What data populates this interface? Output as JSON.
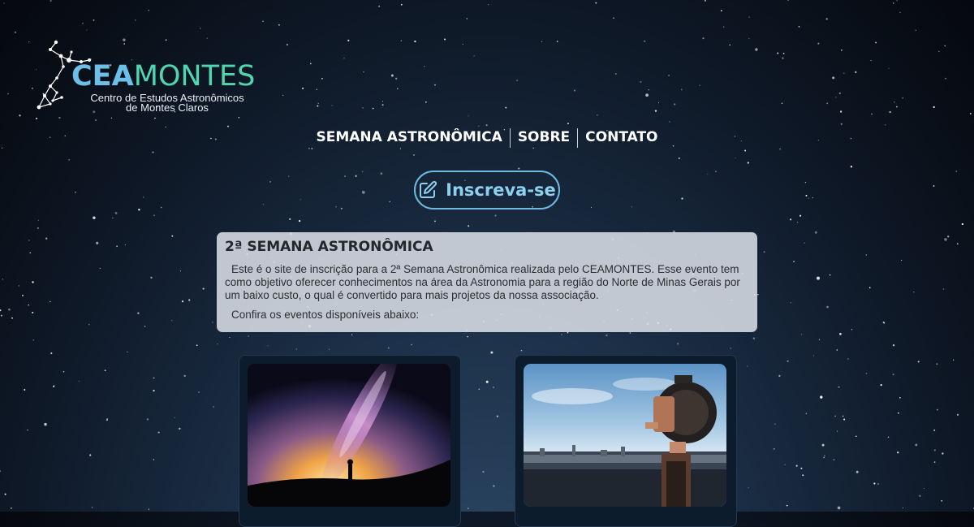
{
  "brand": {
    "logo_primary": "CEA",
    "logo_secondary": "MONTES",
    "logo_sub_line1": "Centro de Estudos Astronômicos",
    "logo_sub_line2": "de Montes Claros"
  },
  "nav": {
    "items": [
      "SEMANA ASTRONÔMICA",
      "SOBRE",
      "CONTATO"
    ]
  },
  "cta": {
    "label": "Inscreva-se",
    "icon": "edit-icon"
  },
  "intro": {
    "title": "2ª SEMANA ASTRONÔMICA",
    "paragraph": "Este é o site de inscrição para a 2ª Semana Astronômica realizada pelo CEAMONTES. Esse evento tem como objetivo oferecer conhecimentos na área da Astronomia para a região do Norte de Minas Gerais por um baixo custo, o qual é convertido para mais projetos da nossa associação.",
    "note": "Confira os eventos disponíveis abaixo:"
  },
  "colors": {
    "accent": "#6fbbe0",
    "logo_cea": "#6cc0e8",
    "logo_montes": "#4fd6b0"
  }
}
